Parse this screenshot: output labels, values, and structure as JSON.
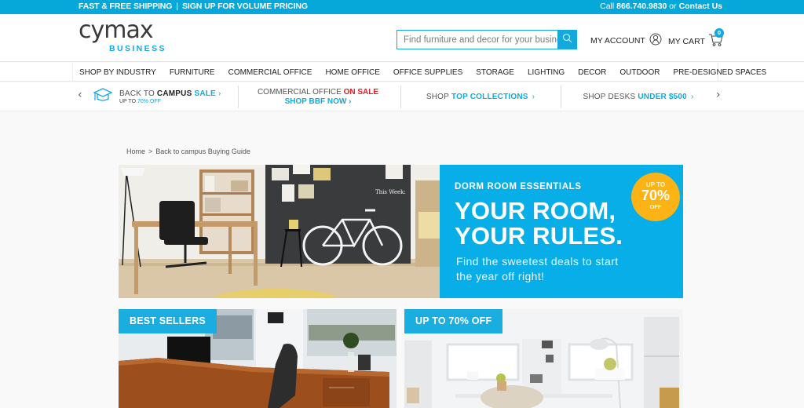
{
  "topbar": {
    "shipping": "FAST & FREE SHIPPING",
    "separator": "|",
    "volume": "SIGN UP FOR VOLUME PRICING",
    "call_prefix": "Call",
    "phone": "866.740.9830",
    "or": "or",
    "contact": "Contact Us"
  },
  "header": {
    "logo_word": "cymax",
    "logo_sub": "BUSINESS",
    "search_placeholder": "Find furniture and decor for your business",
    "search_icon": "search-icon",
    "account_label": "MY ACCOUNT",
    "account_icon": "user-icon",
    "cart_label": "MY CART",
    "cart_icon": "cart-icon",
    "cart_count": "0"
  },
  "nav": {
    "items": [
      {
        "label": "SHOP BY INDUSTRY"
      },
      {
        "label": "FURNITURE"
      },
      {
        "label": "COMMERCIAL OFFICE"
      },
      {
        "label": "HOME OFFICE"
      },
      {
        "label": "OFFICE SUPPLIES"
      },
      {
        "label": "STORAGE"
      },
      {
        "label": "LIGHTING"
      },
      {
        "label": "DECOR"
      },
      {
        "label": "OUTDOOR"
      },
      {
        "label": "PRE-DESIGNED SPACES"
      }
    ]
  },
  "promo": {
    "prev": "‹",
    "next": "›",
    "campus": {
      "pre": "BACK TO",
      "bold": "CAMPUS",
      "accent": "SALE",
      "chevron": "›",
      "sub_pre": "UP TO",
      "sub_hl": "70% OFF",
      "icon": "graduation-cap-icon"
    },
    "commercial": {
      "pre": "COMMERCIAL OFFICE",
      "onsale": "ON SALE",
      "link": "SHOP BBF NOW ›"
    },
    "collections": {
      "pre": "SHOP",
      "hl": "TOP COLLECTIONS",
      "chevron": "›"
    },
    "desks": {
      "pre": "SHOP DESKS",
      "hl": "UNDER $500",
      "chevron": "›"
    }
  },
  "breadcrumb": {
    "home": "Home",
    "sep": ">",
    "current": "Back to campus Buying Guide"
  },
  "hero": {
    "kicker": "DORM ROOM ESSENTIALS",
    "headline_1": "YOUR ROOM,",
    "headline_2": "YOUR RULES.",
    "sub_1": "Find the sweetest deals to start",
    "sub_2": "the year off right!",
    "burst_top": "UP TO",
    "burst_value": "70%",
    "burst_bottom": "OFF",
    "photo_alt": "Dorm room with desk, chair, chalkboard wall and white bicycle"
  },
  "tiles": [
    {
      "tag": "BEST SELLERS",
      "alt": "Office with wooden L-shaped desk and leather chair"
    },
    {
      "tag": "UP TO 70% OFF",
      "alt": "Bright white study room with desk and lamp"
    }
  ],
  "colors": {
    "brand": "#13a9dc",
    "topbar": "#06a7d9",
    "sale_red": "#e01c24",
    "burst": "#fbb316",
    "hero_panel": "#08aee8"
  }
}
